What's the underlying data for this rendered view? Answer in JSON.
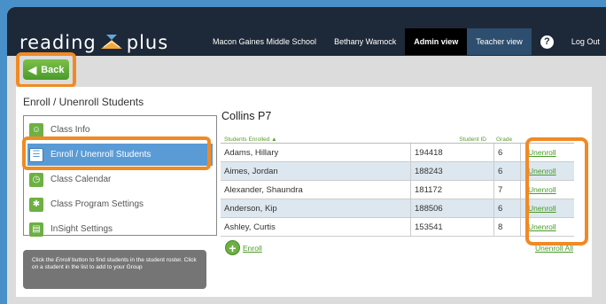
{
  "header": {
    "logo_text_left": "reading",
    "logo_text_right": "plus",
    "nav": [
      "Macon Gaines Middle School",
      "Bethany Wamock",
      "Admin view",
      "Teacher view"
    ],
    "help_glyph": "?",
    "logout": "Log Out"
  },
  "back": {
    "label": "Back",
    "icon": "chevron-left-icon"
  },
  "page_title": "Enroll / Unenroll Students",
  "menu": [
    {
      "label": "Class Info",
      "icon": "people-icon"
    },
    {
      "label": "Enroll / Unenroll Students",
      "icon": "roster-icon",
      "selected": true
    },
    {
      "label": "Class Calendar",
      "icon": "clock-icon"
    },
    {
      "label": "Class Program Settings",
      "icon": "runner-icon"
    },
    {
      "label": "InSight Settings",
      "icon": "chart-icon"
    }
  ],
  "hint": {
    "prefix": "Click the ",
    "emphasis": "Enroll",
    "suffix": " button to find students in the student roster. Click on a student in the list to add to your Group"
  },
  "class_title": "Collins P7",
  "roster": {
    "headers": {
      "name": "Students Enrolled ▲",
      "id": "Student ID",
      "grade": "Grade"
    },
    "rows": [
      {
        "name": "Adams, Hillary",
        "id": "194418",
        "grade": "6",
        "action": "Unenroll"
      },
      {
        "name": "Aimes, Jordan",
        "id": "188243",
        "grade": "6",
        "action": "Unenroll"
      },
      {
        "name": "Alexander, Shaundra",
        "id": "181172",
        "grade": "7",
        "action": "Unenroll"
      },
      {
        "name": "Anderson, Kip",
        "id": "188506",
        "grade": "6",
        "action": "Unenroll"
      },
      {
        "name": "Ashley, Curtis",
        "id": "153541",
        "grade": "8",
        "action": "Unenroll"
      }
    ]
  },
  "enroll_label": "Enroll",
  "unenroll_all_label": "Unenroll All",
  "colors": {
    "accent_green": "#6db043",
    "highlight_orange": "#f08a24",
    "selected_blue": "#5a9bd5"
  }
}
